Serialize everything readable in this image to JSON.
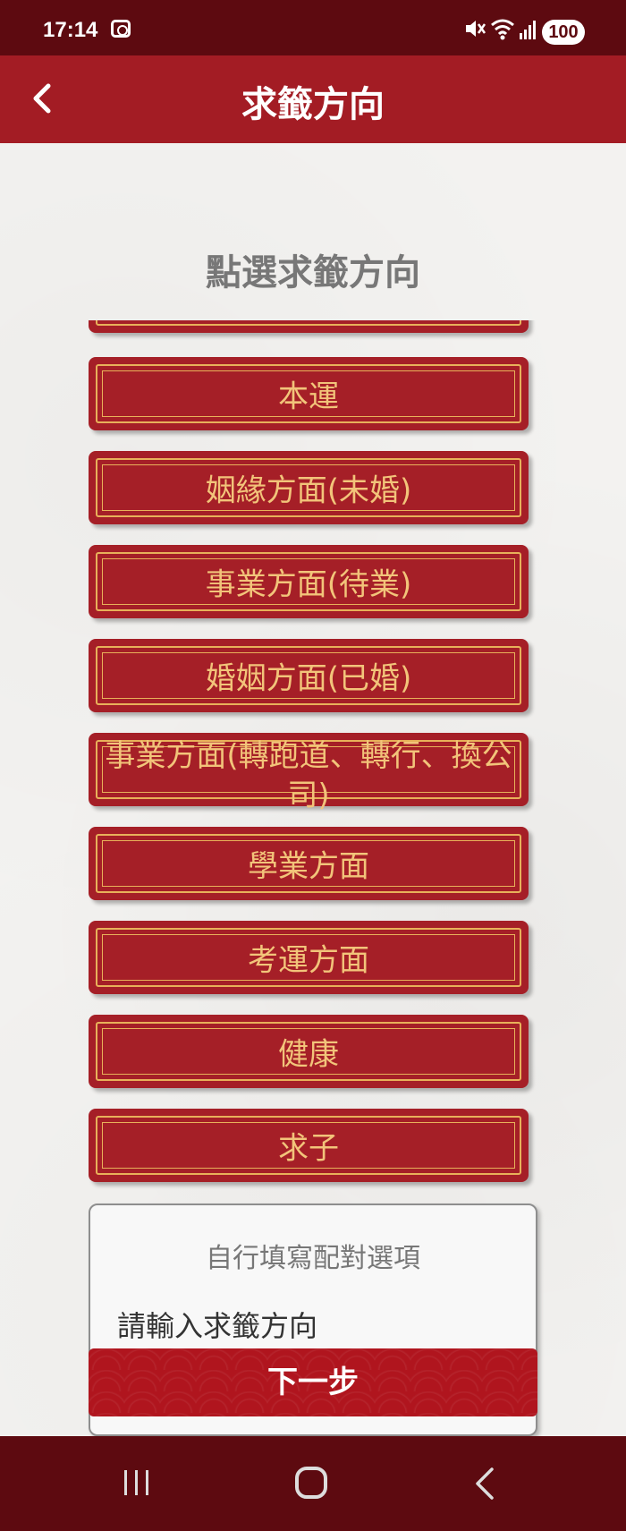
{
  "status_bar": {
    "time": "17:14",
    "battery": "100"
  },
  "header": {
    "title": "求籤方向"
  },
  "section": {
    "heading": "點選求籤方向"
  },
  "options": [
    {
      "label": ""
    },
    {
      "label": "本運"
    },
    {
      "label": "姻緣方面(未婚)"
    },
    {
      "label": "事業方面(待業)"
    },
    {
      "label": "婚姻方面(已婚)"
    },
    {
      "label": "事業方面(轉跑道、轉行、換公司)"
    },
    {
      "label": "學業方面"
    },
    {
      "label": "考運方面"
    },
    {
      "label": "健康"
    },
    {
      "label": "求子"
    }
  ],
  "custom": {
    "title": "自行填寫配對選項",
    "placeholder": "請輸入求籤方向"
  },
  "next_button": {
    "label": "下一步"
  },
  "colors": {
    "header": "#a31c24",
    "status": "#5d0a10",
    "button_fill": "#a51f27",
    "button_text": "#f2c47a",
    "border_gold": "#e8b15a"
  }
}
